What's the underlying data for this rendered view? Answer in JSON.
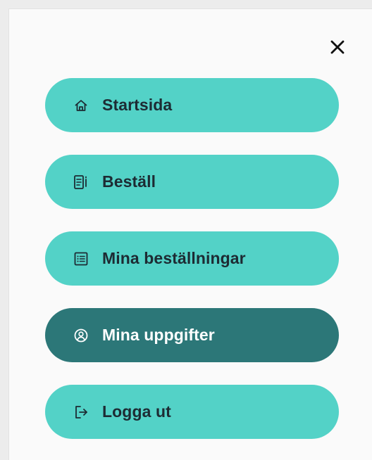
{
  "menu": {
    "close_icon": "close-icon",
    "items": [
      {
        "label": "Startsida",
        "icon": "home-icon",
        "active": false
      },
      {
        "label": "Beställ",
        "icon": "order-form-icon",
        "active": false
      },
      {
        "label": "Mina beställningar",
        "icon": "list-icon",
        "active": false
      },
      {
        "label": "Mina uppgifter",
        "icon": "user-icon",
        "active": true
      },
      {
        "label": "Logga ut",
        "icon": "logout-icon",
        "active": false
      }
    ]
  },
  "colors": {
    "item_background": "#53d2c7",
    "active_item_background": "#2c7778",
    "item_text": "#1d2b33",
    "active_item_text": "#ffffff"
  }
}
